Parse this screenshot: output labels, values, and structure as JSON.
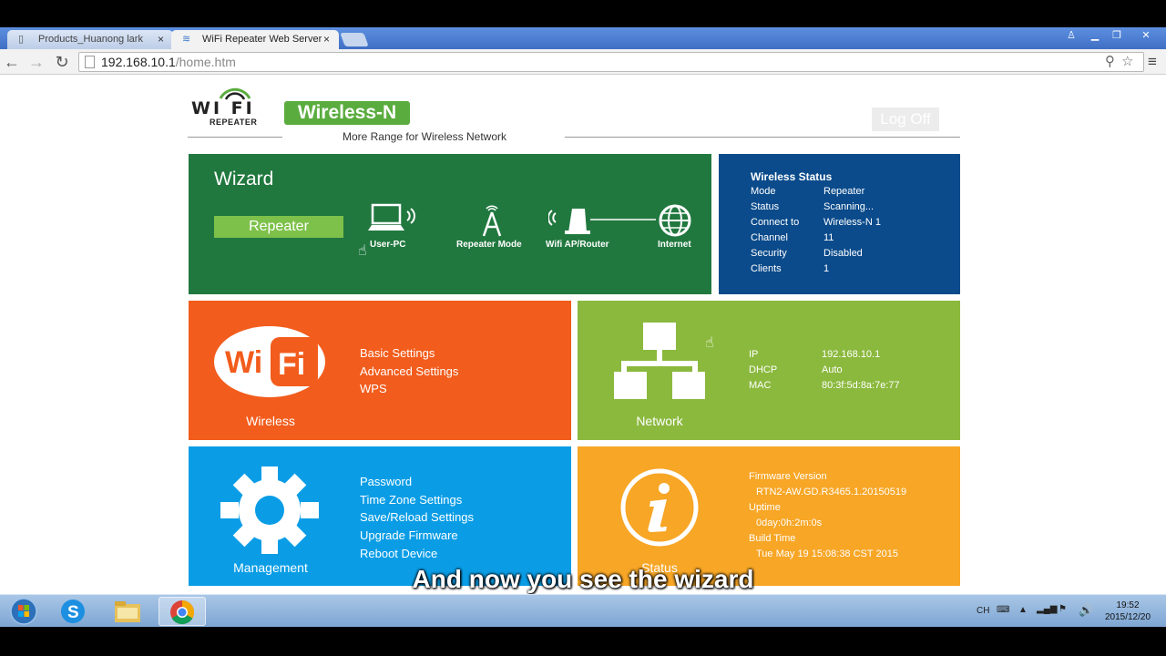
{
  "browser": {
    "tabs": [
      {
        "label": "Products_Huanong lark",
        "close": "×"
      },
      {
        "label": "WiFi Repeater Web Server",
        "close": "×"
      }
    ],
    "url_host": "192.168.10.1",
    "url_path": "/home.htm"
  },
  "header": {
    "logo_word": "WI FI",
    "logo_sub": "REPEATER",
    "badge": "Wireless-N",
    "tagline": "More Range for Wireless Network",
    "logoff": "Log Off"
  },
  "wizard": {
    "title": "Wizard",
    "mode_button": "Repeater",
    "steps": [
      "User-PC",
      "Repeater Mode",
      "Wifi AP/Router",
      "Internet"
    ]
  },
  "wireless_status": {
    "title": "Wireless Status",
    "rows": [
      {
        "k": "Mode",
        "v": "Repeater"
      },
      {
        "k": "Status",
        "v": "Scanning..."
      },
      {
        "k": "Connect to",
        "v": "Wireless-N 1"
      },
      {
        "k": "Channel",
        "v": "11"
      },
      {
        "k": "Security",
        "v": "Disabled"
      },
      {
        "k": "Clients",
        "v": "1"
      }
    ]
  },
  "wireless": {
    "label": "Wireless",
    "links": [
      "Basic Settings",
      "Advanced Settings",
      "WPS"
    ]
  },
  "network": {
    "label": "Network",
    "rows": [
      {
        "k": "IP",
        "v": "192.168.10.1"
      },
      {
        "k": "DHCP",
        "v": "Auto"
      },
      {
        "k": "MAC",
        "v": "80:3f:5d:8a:7e:77"
      }
    ]
  },
  "management": {
    "label": "Management",
    "links": [
      "Password",
      "Time Zone Settings",
      "Save/Reload Settings",
      "Upgrade Firmware",
      "Reboot Device"
    ]
  },
  "status": {
    "label": "Status",
    "rows": [
      "Firmware Version",
      "RTN2-AW.GD.R3465.1.20150519",
      "Uptime",
      "0day:0h:2m:0s",
      "Build Time",
      "Tue May 19 15:08:38 CST 2015"
    ]
  },
  "caption": "And now you see the wizard",
  "taskbar": {
    "lang": "CH",
    "time": "19:52",
    "date": "2015/12/20"
  },
  "colors": {
    "wizard": "#21783f",
    "wireless_status": "#0b4b8b",
    "wireless": "#f25c1c",
    "network": "#8bb93e",
    "management": "#0a9de6",
    "status": "#f7a626"
  }
}
